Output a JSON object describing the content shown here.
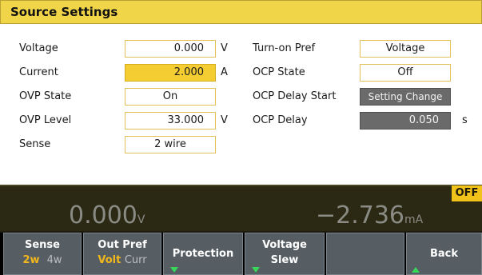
{
  "title": "Source Settings",
  "left": {
    "voltage": {
      "label": "Voltage",
      "value": "0.000",
      "unit": "V"
    },
    "current": {
      "label": "Current",
      "value": "2.000",
      "unit": "A"
    },
    "ovp_state": {
      "label": "OVP State",
      "value": "On"
    },
    "ovp_level": {
      "label": "OVP Level",
      "value": "33.000",
      "unit": "V"
    },
    "sense": {
      "label": "Sense",
      "value": "2 wire"
    }
  },
  "right": {
    "turn_on_pref": {
      "label": "Turn-on Pref",
      "value": "Voltage"
    },
    "ocp_state": {
      "label": "OCP State",
      "value": "Off"
    },
    "ocp_delay_start": {
      "label": "OCP Delay Start",
      "value": "Setting Change"
    },
    "ocp_delay": {
      "label": "OCP Delay",
      "value": "0.050",
      "unit": "s"
    }
  },
  "meter": {
    "voltage_value": "0.000",
    "voltage_unit": "V",
    "current_value": "−2.736",
    "current_unit": "mA",
    "output_state": "OFF"
  },
  "softkeys": {
    "sense": {
      "line1": "Sense",
      "opt_a": "2w",
      "opt_b": "4w"
    },
    "out_pref": {
      "line1": "Out Pref",
      "opt_a": "Volt",
      "opt_b": "Curr"
    },
    "protection": {
      "line1": "Protection"
    },
    "voltage_slew": {
      "line1": "Voltage",
      "line2": "Slew"
    },
    "back": {
      "line1": "Back"
    }
  },
  "colors": {
    "title_bar": "#f0d548",
    "active_field": "#f4cd33",
    "selected_option": "#f2b71b",
    "softkey_bg": "#565e64",
    "arrow": "#37d85a",
    "off_badge": "#f0c21a"
  },
  "icons": [
    "down-arrow-icon",
    "up-arrow-icon"
  ]
}
